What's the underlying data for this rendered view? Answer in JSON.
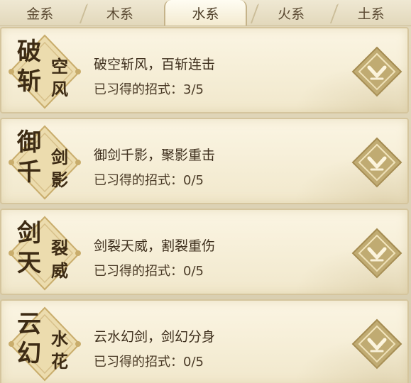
{
  "tabs": [
    {
      "label": "金系",
      "active": false
    },
    {
      "label": "木系",
      "active": false
    },
    {
      "label": "水系",
      "active": true
    },
    {
      "label": "火系",
      "active": false
    },
    {
      "label": "土系",
      "active": false
    }
  ],
  "skills": [
    {
      "glyphs": [
        "破",
        "斩",
        "空",
        "风"
      ],
      "title": "破空斩风，百斩连击",
      "progress_label": "已习得的招式：",
      "learned": 3,
      "total": 5,
      "progress_text": "3/5"
    },
    {
      "glyphs": [
        "御",
        "千",
        "剑",
        "影"
      ],
      "title": "御剑千影，聚影重击",
      "progress_label": "已习得的招式：",
      "learned": 0,
      "total": 5,
      "progress_text": "0/5"
    },
    {
      "glyphs": [
        "剑",
        "天",
        "裂",
        "威"
      ],
      "title": "剑裂天威，割裂重伤",
      "progress_label": "已习得的招式：",
      "learned": 0,
      "total": 5,
      "progress_text": "0/5"
    },
    {
      "glyphs": [
        "云",
        "幻",
        "水",
        "花"
      ],
      "title": "云水幻剑，剑幻分身",
      "progress_label": "已习得的招式：",
      "learned": 0,
      "total": 5,
      "progress_text": "0/5"
    }
  ],
  "colors": {
    "accent_gold": "#b59b5e",
    "text_dark": "#3d2e1c",
    "card_bg": "#f6eed6"
  },
  "icons": {
    "expand": "chevron-down-diamond-icon",
    "emblem": "scroll-seal-emblem"
  }
}
